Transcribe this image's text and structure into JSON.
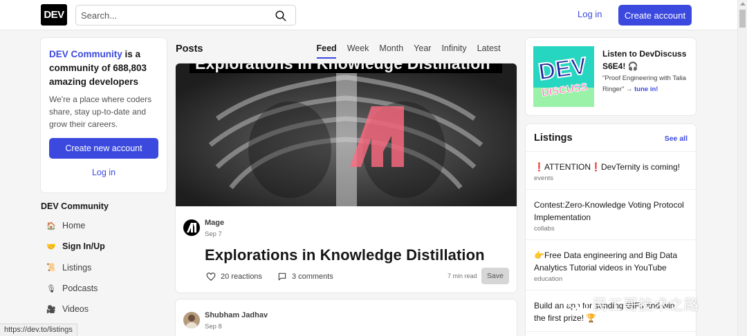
{
  "header": {
    "logo_text": "DEV",
    "search_placeholder": "Search...",
    "login_label": "Log in",
    "create_account_label": "Create account"
  },
  "intro": {
    "brand": "DEV Community",
    "rest": " is a community of 688,803 amazing developers",
    "text": "We're a place where coders share, stay up-to-date and grow their careers.",
    "create_label": "Create new account",
    "login_label": "Log in"
  },
  "sidebar": {
    "heading": "DEV Community",
    "items": [
      {
        "label": "Home",
        "icon": "house-icon",
        "glyph": "🏠"
      },
      {
        "label": "Sign In/Up",
        "icon": "handshake-icon",
        "glyph": "🤝"
      },
      {
        "label": "Listings",
        "icon": "scroll-icon",
        "glyph": "📜"
      },
      {
        "label": "Podcasts",
        "icon": "microphone-icon",
        "glyph": "🎙"
      },
      {
        "label": "Videos",
        "icon": "video-camera-icon",
        "glyph": "🎥"
      }
    ]
  },
  "feed": {
    "heading": "Posts",
    "tabs": [
      "Feed",
      "Week",
      "Month",
      "Year",
      "Infinity",
      "Latest"
    ],
    "active_tab": "Feed",
    "posts": [
      {
        "cover_text": "Explorations in Knowledge Distillation",
        "author": "Mage",
        "date": "Sep 7",
        "title": "Explorations in Knowledge Distillation",
        "reactions": "20 reactions",
        "comments": "3 comments",
        "read_time": "7 min read",
        "save_label": "Save"
      },
      {
        "author": "Shubham Jadhav",
        "date": "Sep 8"
      }
    ]
  },
  "discuss": {
    "title": "Listen to DevDiscuss S6E4! 🎧",
    "subtitle": "\"Proof Engineering with Talia Ringer\" → ",
    "link": "tune in!",
    "badge_line1": "DEV",
    "badge_line2": "DISCUSS"
  },
  "listings": {
    "heading": "Listings",
    "see_all": "See all",
    "items": [
      {
        "title": "❗ATTENTION❗DevTernity is coming!",
        "tag": "events"
      },
      {
        "title": "Contest:Zero-Knowledge Voting Protocol Implementation",
        "tag": "collabs"
      },
      {
        "title": "👉Free Data engineering and Big Data Analytics Tutorial videos in YouTube",
        "tag": "education"
      },
      {
        "title": "Build an app for sending GIFs and win the first prize! 🏆",
        "tag": ""
      }
    ]
  },
  "status_url": "https://dev.to/listings",
  "watermark": "民工哥技术之路",
  "colors": {
    "accent": "#3b49df",
    "badge_green": "#27d6c0"
  }
}
